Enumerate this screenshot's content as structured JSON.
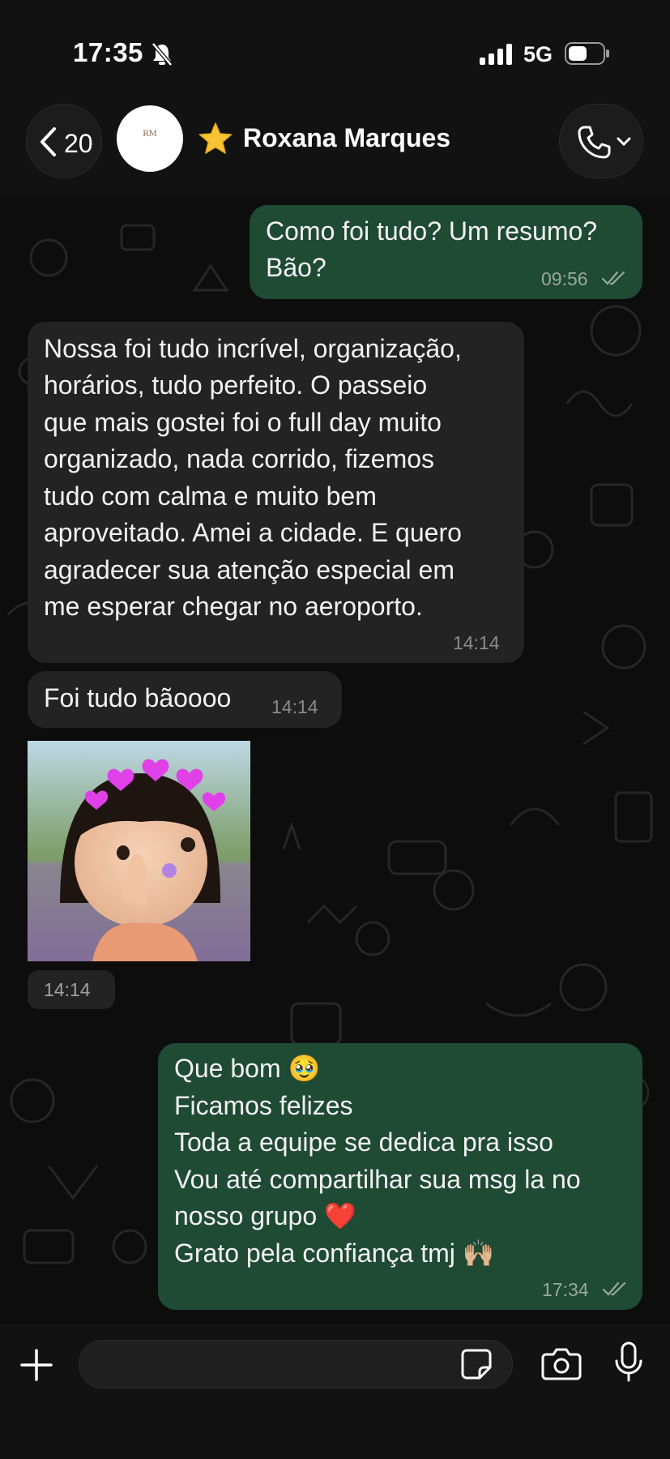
{
  "status_bar": {
    "time": "17:35",
    "network": "5G"
  },
  "header": {
    "back_count": "20",
    "avatar_initials": "RM",
    "contact_name": "Roxana Marques"
  },
  "messages": [
    {
      "dir": "out",
      "lines": [
        "Como foi tudo? Um resumo?",
        "Bão?"
      ],
      "time": "09:56"
    },
    {
      "dir": "in",
      "lines": [
        "Nossa foi tudo incrível, organização,",
        "horários, tudo perfeito. O passeio",
        "que mais gostei foi o full day muito",
        "organizado, nada corrido, fizemos",
        "tudo com calma e muito bem",
        "aproveitado. Amei a cidade. E quero",
        "agradecer sua atenção especial em",
        "me esperar chegar no aeroporto."
      ],
      "time": "14:14"
    },
    {
      "dir": "in",
      "lines": [
        "Foi tudo bãoooo"
      ],
      "time": "14:14"
    },
    {
      "dir": "in",
      "type": "sticker",
      "time": "14:14"
    },
    {
      "dir": "out",
      "lines": [
        "Que bom 🥹",
        "Ficamos felizes",
        "Toda a equipe se dedica pra isso",
        "Vou até compartilhar sua msg la no",
        "nosso grupo ❤️",
        "Grato pela confiança tmj 🙌🏼"
      ],
      "time": "17:34"
    }
  ],
  "input": {
    "placeholder": ""
  },
  "colors": {
    "outgoing": "#1f4a34",
    "incoming": "#232323",
    "background": "#0d0d0d"
  }
}
